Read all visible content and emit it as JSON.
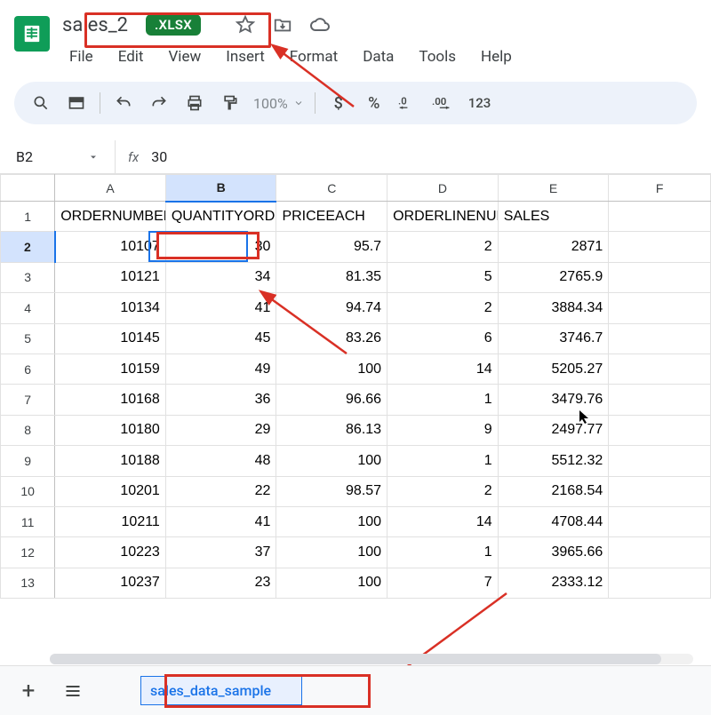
{
  "doc": {
    "title": "sales_2",
    "badge": ".XLSX"
  },
  "menu": {
    "file": "File",
    "edit": "Edit",
    "view": "View",
    "insert": "Insert",
    "format": "Format",
    "data": "Data",
    "tools": "Tools",
    "help": "Help"
  },
  "toolbar": {
    "zoom": "100%",
    "num123": "123"
  },
  "formula": {
    "cell": "B2",
    "value": "30"
  },
  "columns": {
    "a": "A",
    "b": "B",
    "c": "C",
    "d": "D",
    "e": "E",
    "f": "F"
  },
  "rowHeads": {
    "r1": "1",
    "r2": "2",
    "r3": "3",
    "r4": "4",
    "r5": "5",
    "r6": "6",
    "r7": "7",
    "r8": "8",
    "r9": "9",
    "r10": "10",
    "r11": "11",
    "r12": "12",
    "r13": "13"
  },
  "headers": {
    "a": "ORDERNUMBER",
    "b": "QUANTITYORDERED",
    "c": "PRICEEACH",
    "d": "ORDERLINENUMBER",
    "e": "SALES"
  },
  "rows": {
    "r2": {
      "a": "10107",
      "b": "30",
      "c": "95.7",
      "d": "2",
      "e": "2871"
    },
    "r3": {
      "a": "10121",
      "b": "34",
      "c": "81.35",
      "d": "5",
      "e": "2765.9"
    },
    "r4": {
      "a": "10134",
      "b": "41",
      "c": "94.74",
      "d": "2",
      "e": "3884.34"
    },
    "r5": {
      "a": "10145",
      "b": "45",
      "c": "83.26",
      "d": "6",
      "e": "3746.7"
    },
    "r6": {
      "a": "10159",
      "b": "49",
      "c": "100",
      "d": "14",
      "e": "5205.27"
    },
    "r7": {
      "a": "10168",
      "b": "36",
      "c": "96.66",
      "d": "1",
      "e": "3479.76"
    },
    "r8": {
      "a": "10180",
      "b": "29",
      "c": "86.13",
      "d": "9",
      "e": "2497.77"
    },
    "r9": {
      "a": "10188",
      "b": "48",
      "c": "100",
      "d": "1",
      "e": "5512.32"
    },
    "r10": {
      "a": "10201",
      "b": "22",
      "c": "98.57",
      "d": "2",
      "e": "2168.54"
    },
    "r11": {
      "a": "10211",
      "b": "41",
      "c": "100",
      "d": "14",
      "e": "4708.44"
    },
    "r12": {
      "a": "10223",
      "b": "37",
      "c": "100",
      "d": "1",
      "e": "3965.66"
    },
    "r13": {
      "a": "10237",
      "b": "23",
      "c": "100",
      "d": "7",
      "e": "2333.12"
    }
  },
  "sheet": {
    "name": "sales_data_sample"
  }
}
